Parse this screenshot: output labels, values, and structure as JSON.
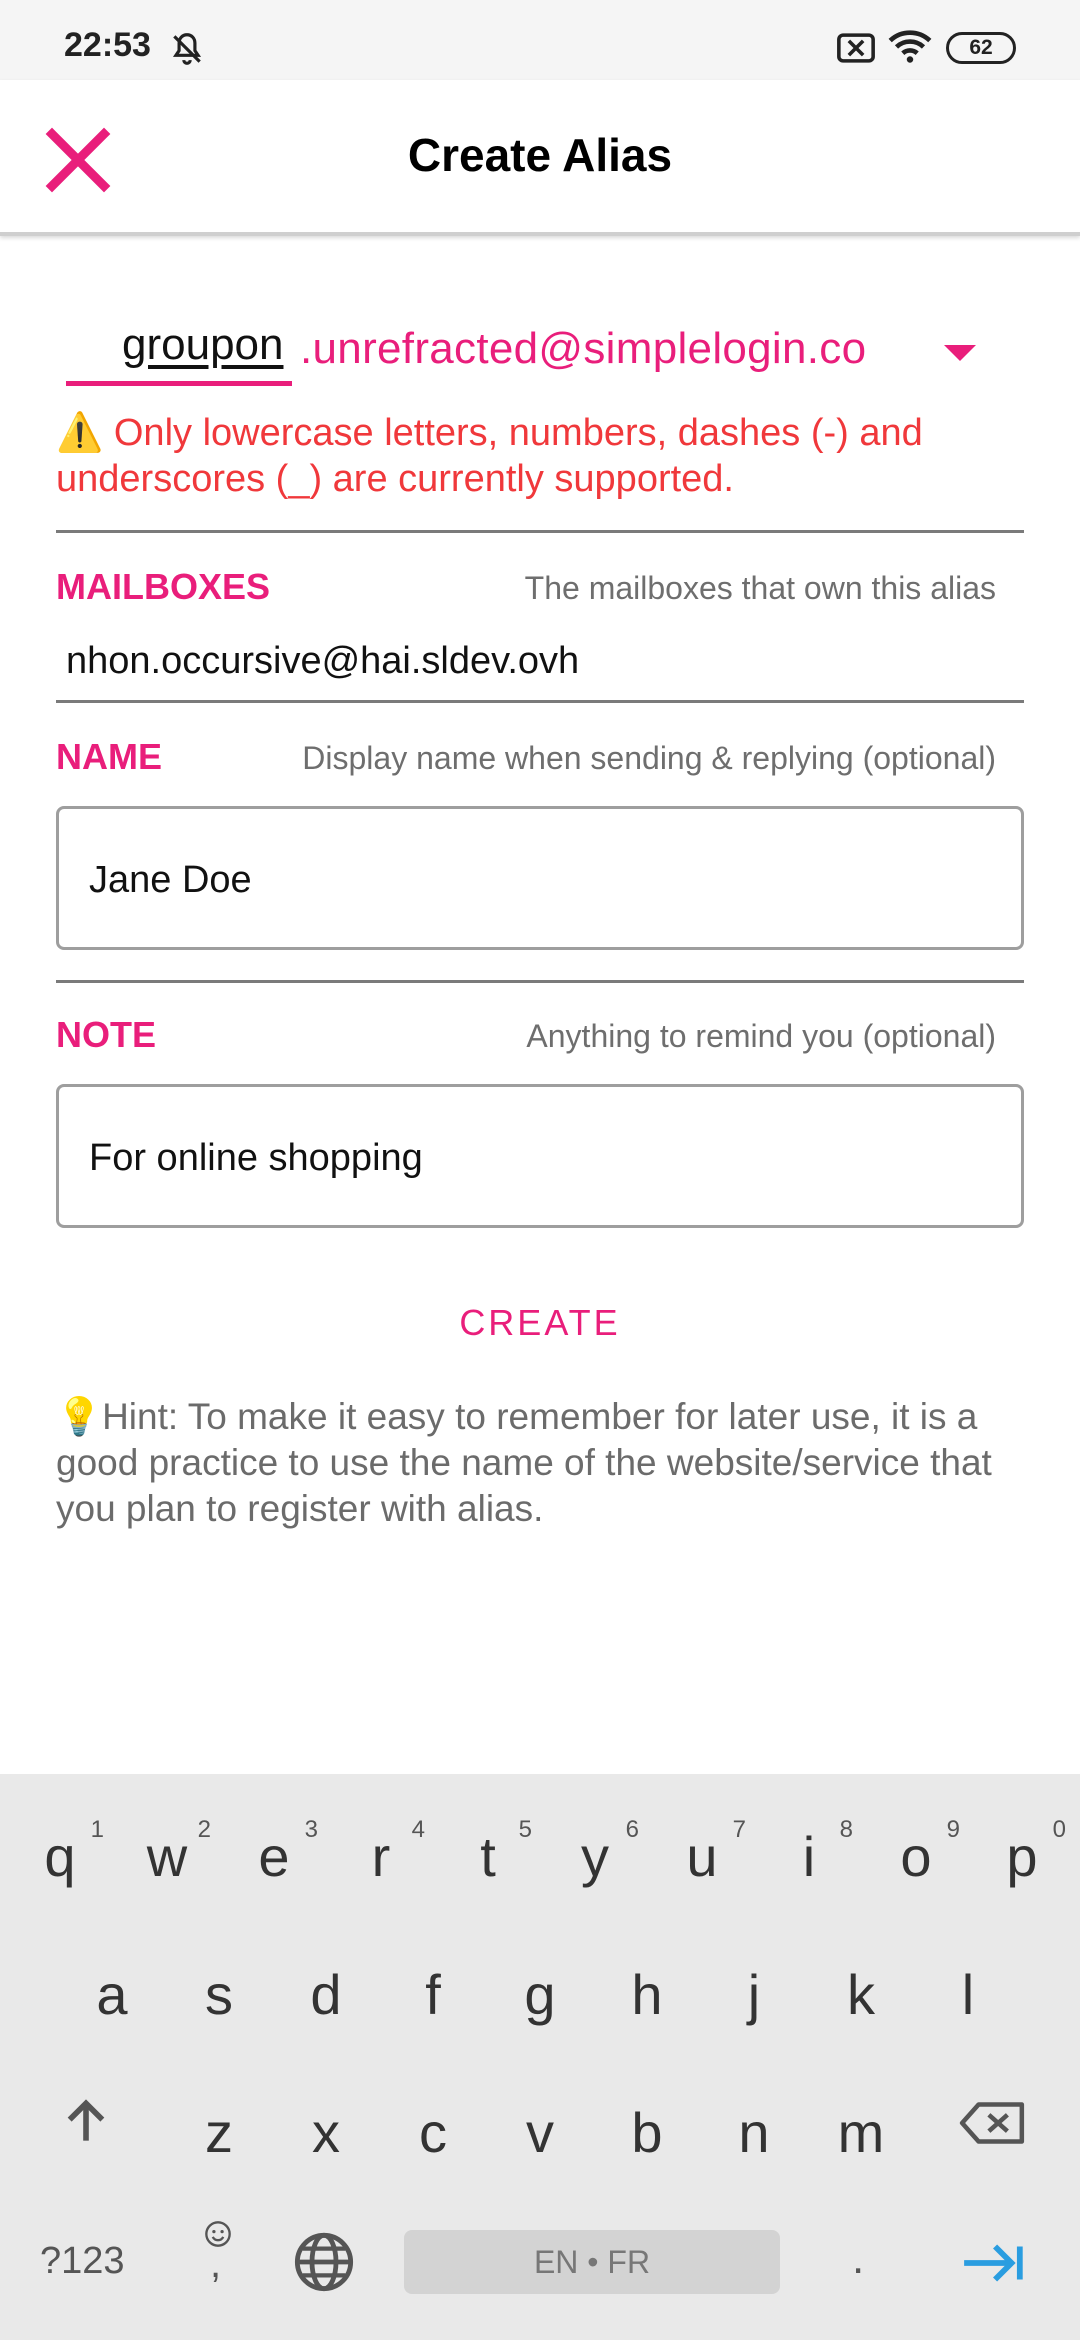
{
  "status_bar": {
    "time": "22:53",
    "battery": "62"
  },
  "app_bar": {
    "title": "Create Alias"
  },
  "alias": {
    "prefix": "groupon",
    "suffix": ".unrefracted@simplelogin.co"
  },
  "warning": "⚠️ Only lowercase letters, numbers, dashes (-) and underscores (_) are currently supported.",
  "mailboxes": {
    "label": "MAILBOXES",
    "hint": "The mailboxes that own this alias",
    "value": "nhon.occursive@hai.sldev.ovh"
  },
  "name": {
    "label": "NAME",
    "hint": "Display name when sending & replying (optional)",
    "value": "Jane Doe"
  },
  "note": {
    "label": "NOTE",
    "hint": "Anything to remind you (optional)",
    "value": "For online shopping"
  },
  "create_label": "CREATE",
  "hint_text": "💡Hint: To make it easy to remember for later use, it is a good practice to use the name of the website/service that you plan to register with alias.",
  "keyboard": {
    "row1": [
      {
        "ch": "q",
        "num": "1"
      },
      {
        "ch": "w",
        "num": "2"
      },
      {
        "ch": "e",
        "num": "3"
      },
      {
        "ch": "r",
        "num": "4"
      },
      {
        "ch": "t",
        "num": "5"
      },
      {
        "ch": "y",
        "num": "6"
      },
      {
        "ch": "u",
        "num": "7"
      },
      {
        "ch": "i",
        "num": "8"
      },
      {
        "ch": "o",
        "num": "9"
      },
      {
        "ch": "p",
        "num": "0"
      }
    ],
    "row2": [
      "a",
      "s",
      "d",
      "f",
      "g",
      "h",
      "j",
      "k",
      "l"
    ],
    "row3": [
      "z",
      "x",
      "c",
      "v",
      "b",
      "n",
      "m"
    ],
    "symbols_label": "?123",
    "comma": ",",
    "space_label": "EN • FR",
    "period": "."
  },
  "colors": {
    "accent": "#e91e7b",
    "warning": "#f0383b",
    "keyboard_bg": "#e9e9e9"
  }
}
